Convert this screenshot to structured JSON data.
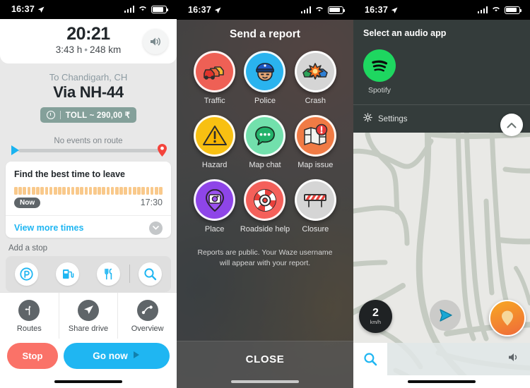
{
  "status_bar": {
    "time": "16:37",
    "location_icon": "location-arrow-icon",
    "signal_icon": "cellular-bars-icon",
    "wifi_icon": "wifi-icon",
    "battery_icon": "battery-icon"
  },
  "panel1": {
    "name": "waze-route-overview",
    "eta": "20:21",
    "duration": "3:43 h",
    "separator": "•",
    "distance": "248 km",
    "sound_icon": "speaker-icon",
    "destination": "To Chandigarh, CH",
    "via": "Via NH-44",
    "toll": {
      "icon": "info-icon",
      "label": "TOLL ~ 290,00 ₹"
    },
    "events_label": "No events on route",
    "start_icon": "navigation-arrow-icon",
    "end_icon": "destination-pin-icon",
    "best_time_card": {
      "title": "Find the best time to leave",
      "now_label": "Now",
      "end_time": "17:30",
      "view_more": "View more times",
      "chevron_icon": "chevron-down-icon",
      "bar_count": 34
    },
    "add_stop_label": "Add a stop",
    "stops": [
      {
        "name": "parking",
        "icon": "parking-icon"
      },
      {
        "name": "gas-station",
        "icon": "gas-pump-icon"
      },
      {
        "name": "food",
        "icon": "fork-knife-icon"
      },
      {
        "name": "search",
        "icon": "search-icon"
      }
    ],
    "actions": [
      {
        "label": "Routes",
        "icon": "routes-fork-icon"
      },
      {
        "label": "Share drive",
        "icon": "paper-plane-icon"
      },
      {
        "label": "Overview",
        "icon": "overview-route-icon"
      }
    ],
    "stop_button": "Stop",
    "go_button": "Go now",
    "go_button_icon": "play-icon",
    "colors": {
      "accent": "#1fb6f2",
      "stop": "#fa7268",
      "toll_bg": "#84a09a",
      "bar": "#f9c98b"
    }
  },
  "panel2": {
    "name": "send-a-report",
    "title": "Send a report",
    "reports": [
      {
        "label": "Traffic",
        "icon": "traffic-cars-icon",
        "color": "#ee6055"
      },
      {
        "label": "Police",
        "icon": "police-officer-icon",
        "color": "#2ab3ee"
      },
      {
        "label": "Crash",
        "icon": "car-crash-icon",
        "color": "#d5d5d5"
      },
      {
        "label": "Hazard",
        "icon": "warning-triangle-icon",
        "color": "#f8c012"
      },
      {
        "label": "Map chat",
        "icon": "chat-bubble-icon",
        "color": "#72e0ac"
      },
      {
        "label": "Map issue",
        "icon": "map-alert-icon",
        "color": "#f07b45"
      },
      {
        "label": "Place",
        "icon": "place-pin-camera-icon",
        "color": "#8e45e8"
      },
      {
        "label": "Roadside help",
        "icon": "life-ring-icon",
        "color": "#f4605a"
      },
      {
        "label": "Closure",
        "icon": "road-barrier-icon",
        "color": "#d5d5d5"
      }
    ],
    "disclaimer": "Reports are public. Your Waze username will appear with your report.",
    "close_label": "CLOSE"
  },
  "panel3": {
    "name": "audio-app-selector",
    "title": "Select an audio app",
    "apps": [
      {
        "name": "Spotify",
        "icon": "spotify-icon",
        "color": "#1ed760"
      }
    ],
    "settings_label": "Settings",
    "settings_icon": "gear-icon",
    "collapse_icon": "chevron-up-icon",
    "speed": {
      "value": "2",
      "unit": "km/h"
    },
    "car_icon": "navigation-cursor-icon",
    "mood_icon": "mood-pin-icon",
    "search_icon": "search-icon",
    "volume_icon": "speaker-icon"
  }
}
